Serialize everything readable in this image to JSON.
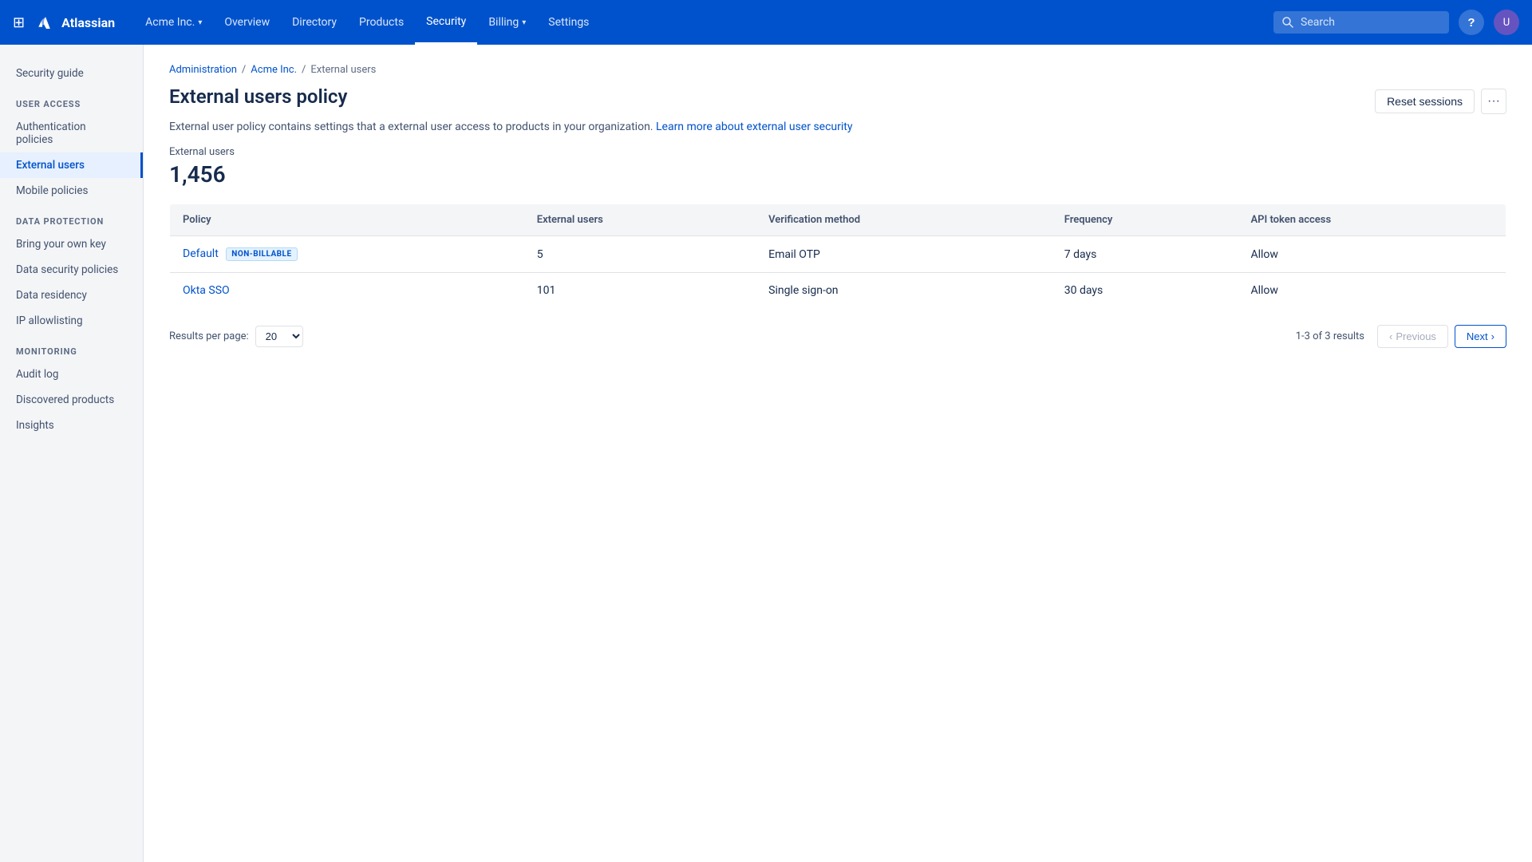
{
  "topnav": {
    "logo_text": "Atlassian",
    "org_name": "Acme Inc.",
    "org_chevron": "▾",
    "links": [
      {
        "label": "Overview",
        "active": false
      },
      {
        "label": "Directory",
        "active": false
      },
      {
        "label": "Products",
        "active": false,
        "has_chevron": false
      },
      {
        "label": "Security",
        "active": true
      },
      {
        "label": "Billing",
        "active": false,
        "has_chevron": true
      },
      {
        "label": "Settings",
        "active": false
      }
    ],
    "search_placeholder": "Search"
  },
  "sidebar": {
    "security_guide_label": "Security guide",
    "sections": [
      {
        "label": "USER ACCESS",
        "items": [
          {
            "label": "Authentication policies",
            "active": false,
            "id": "auth-policies"
          },
          {
            "label": "External users",
            "active": true,
            "id": "external-users"
          },
          {
            "label": "Mobile policies",
            "active": false,
            "id": "mobile-policies"
          }
        ]
      },
      {
        "label": "DATA PROTECTION",
        "items": [
          {
            "label": "Bring your own key",
            "active": false,
            "id": "bring-own-key"
          },
          {
            "label": "Data security policies",
            "active": false,
            "id": "data-security"
          },
          {
            "label": "Data residency",
            "active": false,
            "id": "data-residency"
          },
          {
            "label": "IP allowlisting",
            "active": false,
            "id": "ip-allowlisting"
          }
        ]
      },
      {
        "label": "MONITORING",
        "items": [
          {
            "label": "Audit log",
            "active": false,
            "id": "audit-log"
          },
          {
            "label": "Discovered products",
            "active": false,
            "id": "discovered-products"
          },
          {
            "label": "Insights",
            "active": false,
            "id": "insights"
          }
        ]
      }
    ]
  },
  "breadcrumb": {
    "items": [
      "Administration",
      "Acme Inc.",
      "External users"
    ]
  },
  "page": {
    "title": "External users policy",
    "description": "External user policy contains settings that a external user access to products in your organization.",
    "learn_more_text": "Learn more about external user security",
    "learn_more_url": "#",
    "reset_sessions_label": "Reset sessions",
    "more_label": "···",
    "external_users_label": "External users",
    "external_users_count": "1,456"
  },
  "table": {
    "columns": [
      "Policy",
      "External users",
      "Verification method",
      "Frequency",
      "API token access"
    ],
    "rows": [
      {
        "policy_name": "Default",
        "policy_badge": "NON-BILLABLE",
        "external_users": "5",
        "verification_method": "Email OTP",
        "frequency": "7 days",
        "api_token_access": "Allow"
      },
      {
        "policy_name": "Okta SSO",
        "policy_badge": "",
        "external_users": "101",
        "verification_method": "Single sign-on",
        "frequency": "30 days",
        "api_token_access": "Allow"
      }
    ]
  },
  "pagination": {
    "results_per_page_label": "Results per page:",
    "results_per_page_value": "20",
    "results_info": "1-3 of 3 results",
    "previous_label": "Previous",
    "next_label": "Next"
  }
}
